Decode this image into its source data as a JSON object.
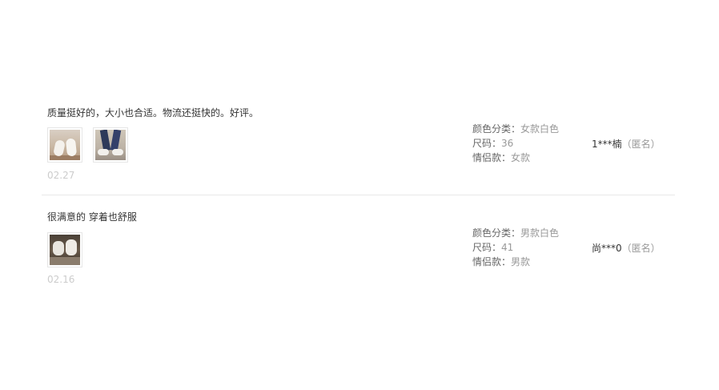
{
  "reviews": [
    {
      "content": "质量挺好的，大小也合适。物流还挺快的。好评。",
      "date": "02.27",
      "sku": [
        {
          "key": "颜色分类：",
          "value": "女款白色"
        },
        {
          "key": "尺码：",
          "value": "36"
        },
        {
          "key": "情侣款：",
          "value": "女款"
        }
      ],
      "user": {
        "name": "1***楠",
        "anon": "（匿名）"
      }
    },
    {
      "content": "很满意的 穿着也舒服",
      "date": "02.16",
      "sku": [
        {
          "key": "颜色分类：",
          "value": "男款白色"
        },
        {
          "key": "尺码：",
          "value": "41"
        },
        {
          "key": "情侣款：",
          "value": "男款"
        }
      ],
      "user": {
        "name": "尚***0",
        "anon": "（匿名）"
      }
    }
  ]
}
